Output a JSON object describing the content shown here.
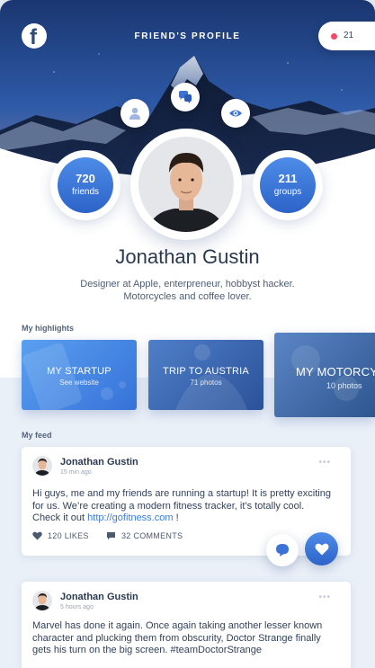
{
  "header": {
    "title": "FRIEND'S PROFILE",
    "logo_letter": "f",
    "notification_count": "21"
  },
  "stats": {
    "friends": {
      "value": "720",
      "label": "friends"
    },
    "groups": {
      "value": "211",
      "label": "groups"
    }
  },
  "profile": {
    "name": "Jonathan Gustin",
    "bio_line1": "Designer at Apple, enterpreneur, hobbyst hacker.",
    "bio_line2": "Motorcycles and coffee lover."
  },
  "highlights": {
    "label": "My highlights",
    "items": [
      {
        "title": "MY STARTUP",
        "subtitle": "See website"
      },
      {
        "title": "TRIP TO AUSTRIA",
        "subtitle": "71 photos"
      },
      {
        "title": "MY MOTORCYCLE",
        "subtitle": "10 photos"
      }
    ]
  },
  "feed": {
    "label": "My feed",
    "posts": [
      {
        "author": "Jonathan Gustin",
        "time": "15 min ago",
        "text_line1": "Hi guys, me and my friends are running a startup! It is pretty exciting",
        "text_line2": "for us. We’re creating a modern fitness tracker, it’s totally cool.",
        "text_line3_prefix": "Check it out ",
        "link": "http://gofitness.com",
        "text_line3_suffix": " !",
        "likes": "120 LIKES",
        "comments": "32 COMMENTS"
      },
      {
        "author": "Jonathan Gustin",
        "time": "5 hours ago",
        "text_line1": "Marvel has done it again. Once again taking another lesser known",
        "text_line2": "character and plucking them from obscurity, Doctor Strange finally",
        "text_line3": "gets his turn on the big screen. #teamDoctorStrange"
      }
    ]
  },
  "colors": {
    "accent": "#3a72d6",
    "notification_dot": "#ef4b67",
    "sky_top": "#1f3f7a",
    "link": "#3b7ddd"
  },
  "icons": [
    "facebook-logo",
    "user-icon",
    "chat-bubbles-icon",
    "eye-icon",
    "heart-icon",
    "comment-icon"
  ]
}
